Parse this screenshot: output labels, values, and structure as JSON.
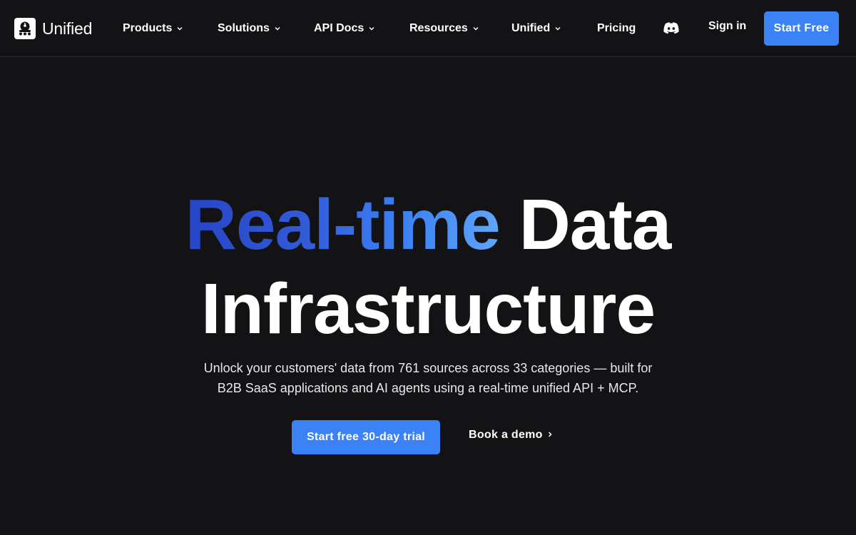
{
  "brand": {
    "name": "Unified",
    "logo_icon": "unified-logo-icon"
  },
  "nav": {
    "items": [
      {
        "label": "Products",
        "has_dropdown": true
      },
      {
        "label": "Solutions",
        "has_dropdown": true
      },
      {
        "label": "API Docs",
        "has_dropdown": true
      },
      {
        "label": "Resources",
        "has_dropdown": true
      },
      {
        "label": "Unified",
        "has_dropdown": true
      },
      {
        "label": "Pricing",
        "has_dropdown": false
      }
    ],
    "discord_icon": "discord-icon",
    "signin_label": "Sign in",
    "start_free_label": "Start Free"
  },
  "hero": {
    "title_highlight": "Real-time",
    "title_line1_rest": "Data",
    "title_line2": "Infrastructure",
    "subtitle_line1": "Unlock your customers' data from 761 sources across 33 categories — built for",
    "subtitle_line2": "B2B SaaS applications and AI agents using a real-time unified API + MCP.",
    "cta_primary": "Start free 30-day trial",
    "cta_secondary": "Book a demo"
  },
  "colors": {
    "background": "#131316",
    "accent": "#3b82f6",
    "gradient_start": "#2745c6",
    "gradient_end": "#60a5fa"
  }
}
